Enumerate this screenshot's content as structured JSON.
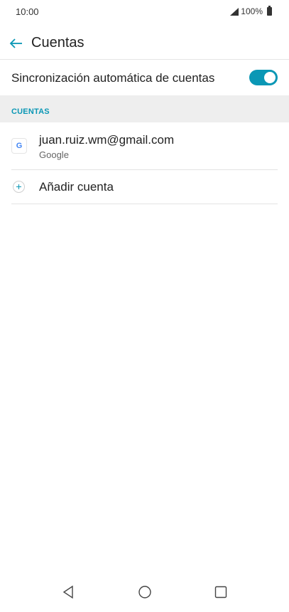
{
  "status_bar": {
    "time": "10:00",
    "battery_level": "100%",
    "icons": [
      "signal-icon",
      "battery-icon"
    ]
  },
  "app_bar": {
    "title": "Cuentas",
    "back_icon": "arrow-left-icon"
  },
  "sync": {
    "label": "Sincronización automática de cuentas",
    "enabled": true
  },
  "accounts_section": {
    "title": "CUENTAS",
    "accounts": [
      {
        "email": "juan.ruiz.wm@gmail.com",
        "type": "Google",
        "icon": "google-icon",
        "icon_glyph": "G"
      }
    ],
    "add_account_label": "Añadir cuenta"
  },
  "nav_bar": {
    "buttons": [
      "back-triangle-icon",
      "home-circle-icon",
      "recents-square-icon"
    ]
  },
  "colors": {
    "accent": "#0a97b5",
    "section_bg": "#eeeeee",
    "text": "#222222",
    "secondary_text": "#666666"
  }
}
